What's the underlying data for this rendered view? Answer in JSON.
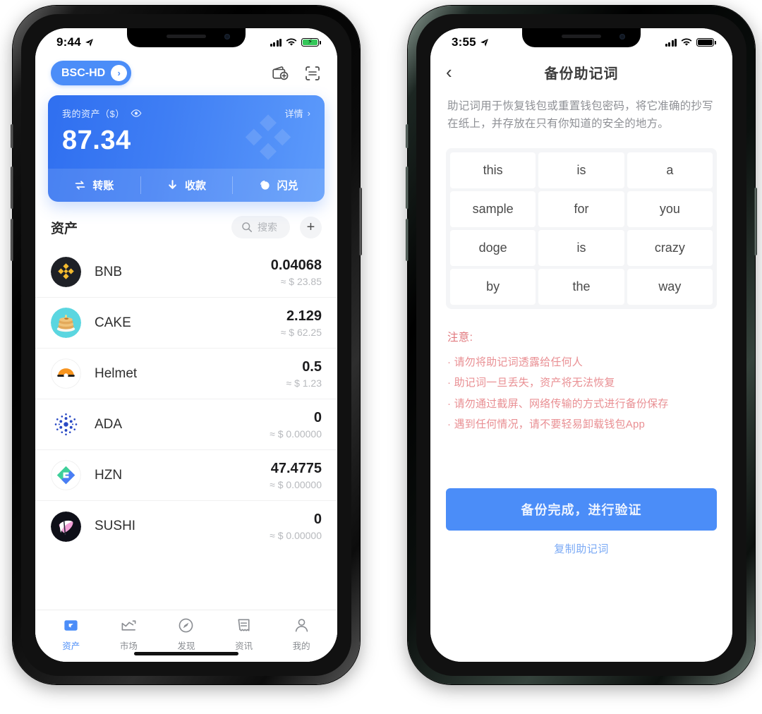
{
  "accent": "#4b8df8",
  "left_phone": {
    "status_bar": {
      "time": "9:44",
      "location_icon": "location-arrow-icon",
      "signal_icon": "cellular-signal-icon",
      "wifi_icon": "wifi-icon",
      "battery_icon": "battery-charging-icon"
    },
    "header": {
      "chain_label": "BSC-HD",
      "chain_chevron": "›",
      "wallet_add_icon": "wallet-add-icon",
      "scan_icon": "scan-qr-icon"
    },
    "balance_card": {
      "label": "我的资产（$）",
      "eye_icon": "eye-icon",
      "detail_label": "详情",
      "detail_chevron": "›",
      "amount": "87.34",
      "watermark_icon": "binance-logo-watermark",
      "actions": [
        {
          "label": "转账",
          "icon": "transfer-icon"
        },
        {
          "label": "收款",
          "icon": "receive-arrow-down-icon"
        },
        {
          "label": "闪兑",
          "icon": "flash-swap-icon"
        }
      ]
    },
    "assets_section": {
      "title": "资产",
      "search_placeholder": "搜索",
      "search_icon": "search-icon",
      "add_label": "+",
      "rows": [
        {
          "symbol": "BNB",
          "amount": "0.04068",
          "usd": "≈ $ 23.85",
          "icon": "bnb-coin-icon"
        },
        {
          "symbol": "CAKE",
          "amount": "2.129",
          "usd": "≈ $ 62.25",
          "icon": "cake-coin-icon"
        },
        {
          "symbol": "Helmet",
          "amount": "0.5",
          "usd": "≈ $ 1.23",
          "icon": "helmet-coin-icon"
        },
        {
          "symbol": "ADA",
          "amount": "0",
          "usd": "≈ $ 0.00000",
          "icon": "ada-coin-icon"
        },
        {
          "symbol": "HZN",
          "amount": "47.4775",
          "usd": "≈ $ 0.00000",
          "icon": "hzn-coin-icon"
        },
        {
          "symbol": "SUSHI",
          "amount": "0",
          "usd": "≈ $ 0.00000",
          "icon": "sushi-coin-icon"
        }
      ]
    },
    "tabbar": [
      {
        "label": "资产",
        "icon": "wallet-icon",
        "active": true
      },
      {
        "label": "市场",
        "icon": "chart-icon",
        "active": false
      },
      {
        "label": "发现",
        "icon": "compass-icon",
        "active": false
      },
      {
        "label": "资讯",
        "icon": "news-icon",
        "active": false
      },
      {
        "label": "我的",
        "icon": "person-icon",
        "active": false
      }
    ]
  },
  "right_phone": {
    "status_bar": {
      "time": "3:55",
      "location_icon": "location-arrow-icon",
      "signal_icon": "cellular-signal-icon",
      "wifi_icon": "wifi-icon",
      "battery_icon": "battery-icon"
    },
    "nav": {
      "back_icon": "‹",
      "title": "备份助记词"
    },
    "description": "助记词用于恢复钱包或重置钱包密码，将它准确的抄写在纸上，并存放在只有你知道的安全的地方。",
    "mnemonic_words": [
      "this",
      "is",
      "a",
      "sample",
      "for",
      "you",
      "doge",
      "is",
      "crazy",
      "by",
      "the",
      "way"
    ],
    "notice": {
      "title": "注意:",
      "items": [
        "· 请勿将助记词透露给任何人",
        "· 助记词一旦丢失，资产将无法恢复",
        "· 请勿通过截屏、网络传输的方式进行备份保存",
        "· 遇到任何情况，请不要轻易卸载钱包App"
      ]
    },
    "cta": {
      "primary_label": "备份完成，进行验证",
      "secondary_label": "复制助记词"
    }
  }
}
